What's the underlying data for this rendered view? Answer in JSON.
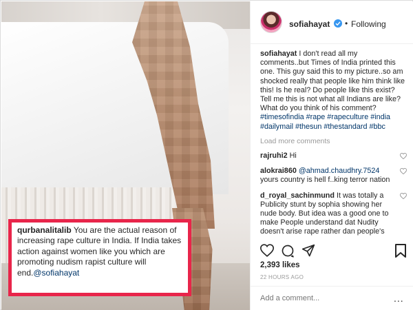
{
  "post": {
    "username": "sofiahayat",
    "follow_separator": "•",
    "follow_status": "Following",
    "caption_user": "sofiahayat",
    "caption_text": "I don't read all my comments..but Times of India printed this one. This guy said this to my picture..so am shocked really that people like him think like this! Is he real? Do people like this exist? Tell me this is not what all Indians are like? What do you think of his comment?",
    "hashtags": "#timesofindia #rape #rapeculture #india #dailymail #thesun #thestandard #bbc",
    "load_more": "Load more comments",
    "likes": "2,393 likes",
    "timestamp": "22 HOURS AGO",
    "add_comment_placeholder": "Add a comment...",
    "more_options": "..."
  },
  "comments": [
    {
      "user": "rajruhi2",
      "text": "Hi",
      "mention": ""
    },
    {
      "user": "alokrai860",
      "mention": "@ahmad.chaudhry.7524",
      "text": "yours country is hell f..king terror nation"
    },
    {
      "user": "d_royal_sachinmund",
      "mention": "",
      "text": "It was totally a Publicity stunt by sophia showing her nude body. But idea was a good one to make People understand dat Nudity doesn't arise rape rather dan people's"
    }
  ],
  "highlight": {
    "user": "qurbanalitalib",
    "text": "You are the actual reason of increasing rape culture in India. If India takes action against women like you which are promoting nudism rapist culture will end.",
    "mention": "@sofiahayat"
  },
  "icons": [
    "verified-badge-icon",
    "heart-icon",
    "comment-icon",
    "share-icon",
    "bookmark-icon",
    "more-options-icon"
  ],
  "colors": {
    "highlight_border": "#e8254a",
    "link": "#003569",
    "verified": "#3897f0",
    "muted": "#999999",
    "text": "#262626"
  }
}
